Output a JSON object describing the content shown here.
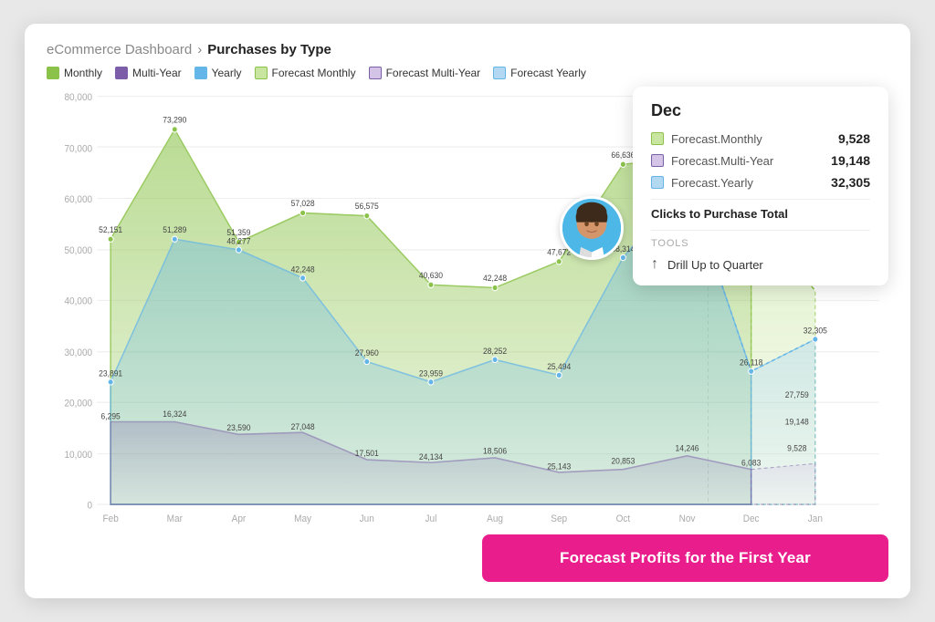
{
  "header": {
    "breadcrumb_base": "eCommerce Dashboard",
    "breadcrumb_sep": "›",
    "breadcrumb_current": "Purchases by Type"
  },
  "legend": {
    "items": [
      {
        "label": "Monthly",
        "color": "#8bc34a"
      },
      {
        "label": "Multi-Year",
        "color": "#7b5ea7"
      },
      {
        "label": "Yearly",
        "color": "#64b5e8"
      },
      {
        "label": "Forecast Monthly",
        "color": "#c8e6a0"
      },
      {
        "label": "Forecast Multi-Year",
        "color": "#d4c5e8"
      },
      {
        "label": "Forecast Yearly",
        "color": "#b3d9f2"
      }
    ]
  },
  "tooltip": {
    "title": "Dec",
    "rows": [
      {
        "label": "Forecast.Monthly",
        "color": "#c8e6a0",
        "value": "9,528"
      },
      {
        "label": "Forecast.Multi-Year",
        "color": "#d4c5e8",
        "value": "19,148"
      },
      {
        "label": "Forecast.Yearly",
        "color": "#b3d9f2",
        "value": "32,305"
      }
    ],
    "subtitle": "Clicks to Purchase Total",
    "tools_label": "TOOLS",
    "drill_action": "Drill Up to Quarter"
  },
  "cta": {
    "label": "Forecast Profits for the First Year"
  },
  "yaxis": {
    "labels": [
      "80,000",
      "70,000",
      "60,000",
      "50,000",
      "40,000",
      "30,000",
      "20,000",
      "10,000",
      "0"
    ]
  },
  "xaxis": {
    "labels": [
      "Feb",
      "Mar",
      "Apr",
      "May",
      "Jun",
      "Jul",
      "Aug",
      "Sep",
      "Oct",
      "Nov",
      "Dec",
      "Jan"
    ]
  }
}
